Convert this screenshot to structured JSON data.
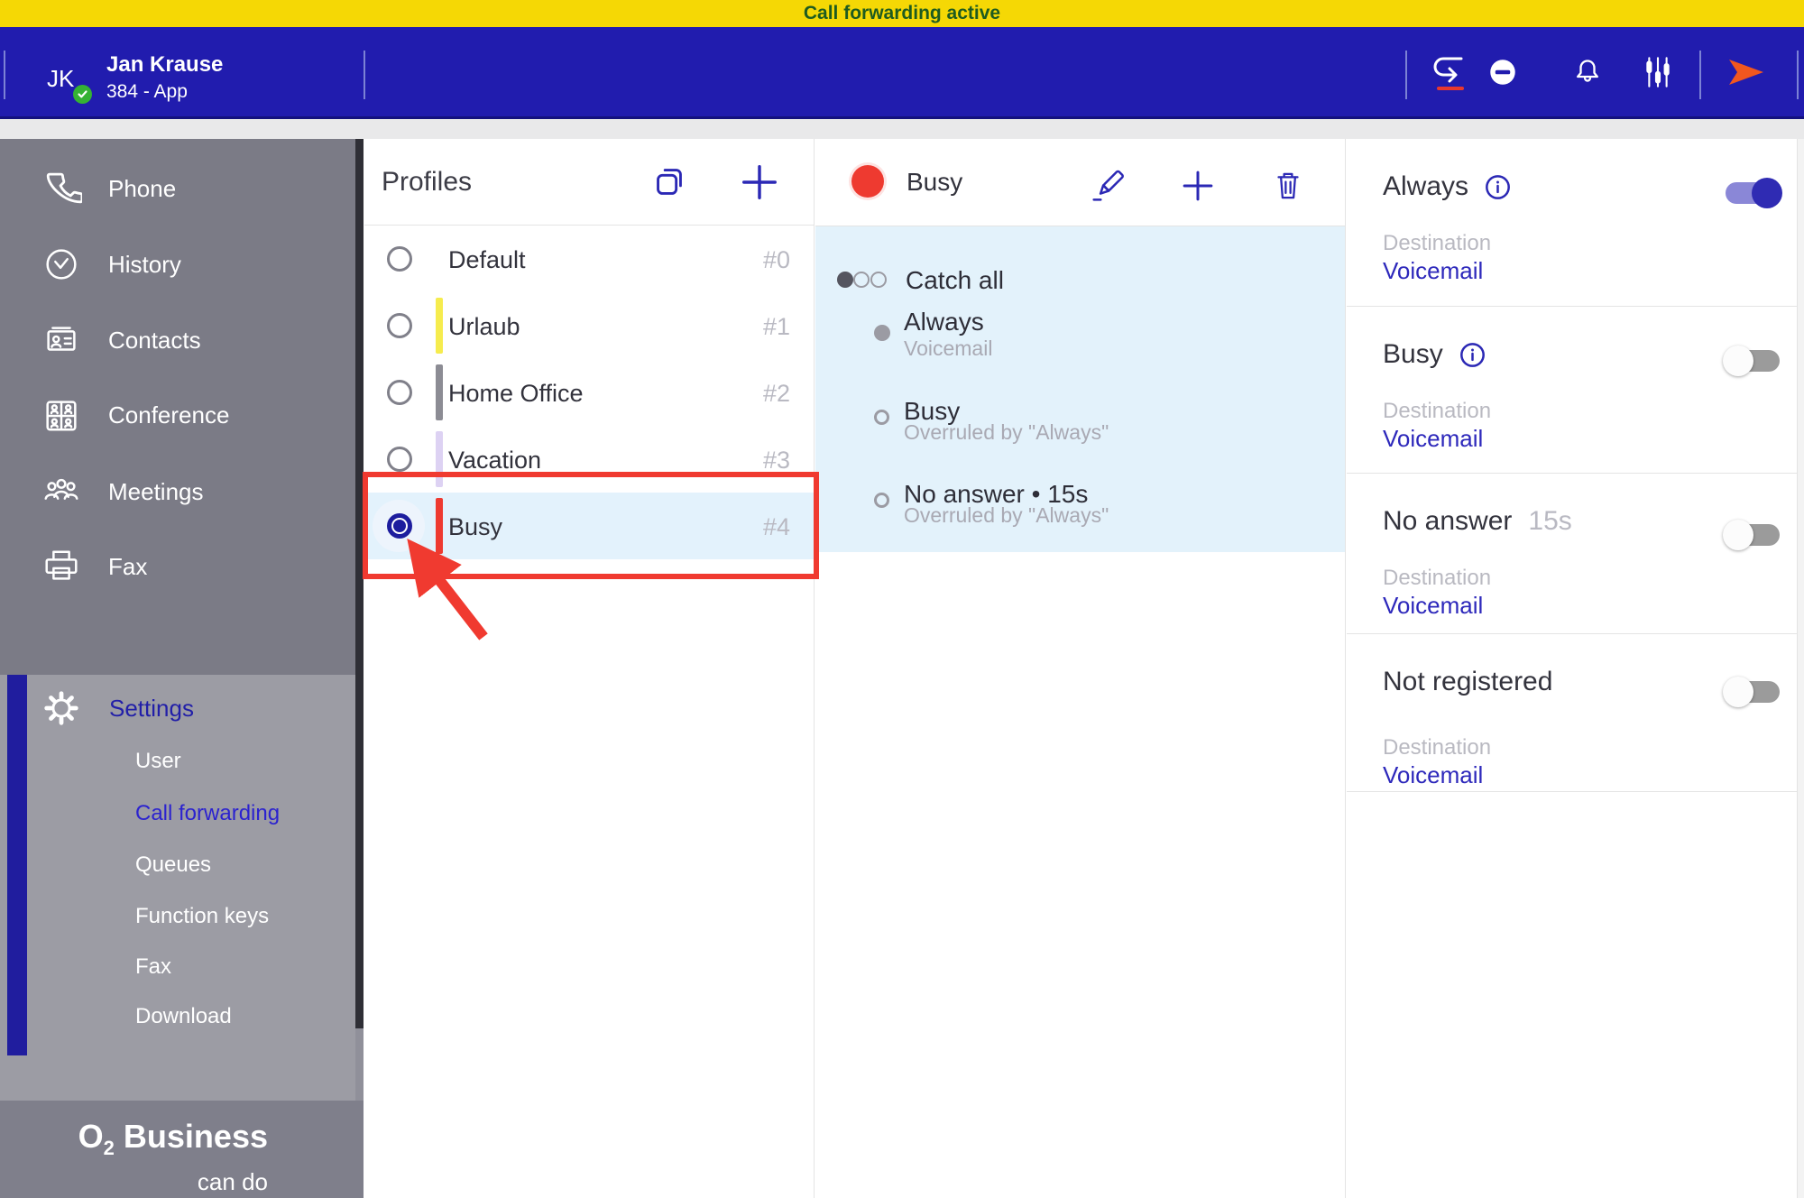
{
  "colors": {
    "banner_bg": "#f5d805",
    "banner_text": "#1e5b20",
    "header_bg": "#211cae",
    "accent_indigo": "#2b28b5",
    "sidebar_bg": "#7b7b86",
    "sidebar_active_bg": "#9c9ca4",
    "selection_blue": "#e3f2fb",
    "alert_red": "#ee3a30",
    "annotation_red": "#f03a30",
    "toggle_on_knob": "#2f2bb3",
    "toggle_on_track": "#8a87d7",
    "toggle_off_knob": "#fcfcfc",
    "toggle_off_track": "#9b9b9b",
    "status_green": "#35b234"
  },
  "banner": {
    "text": "Call forwarding active"
  },
  "header": {
    "initials": "JK",
    "name": "Jan Krause",
    "line2": "384 - App",
    "icons": [
      "call-forwarding-icon",
      "do-not-disturb-icon",
      "notifications-icon",
      "audio-settings-icon",
      "send-icon"
    ]
  },
  "sidebar": {
    "items": [
      {
        "label": "Phone",
        "icon": "phone-icon"
      },
      {
        "label": "History",
        "icon": "history-icon"
      },
      {
        "label": "Contacts",
        "icon": "contacts-icon"
      },
      {
        "label": "Conference",
        "icon": "conference-icon"
      },
      {
        "label": "Meetings",
        "icon": "meetings-icon"
      },
      {
        "label": "Fax",
        "icon": "fax-icon"
      }
    ],
    "settings": {
      "label": "Settings",
      "icon": "gear-icon",
      "subitems": [
        {
          "label": "User",
          "active": false
        },
        {
          "label": "Call forwarding",
          "active": true
        },
        {
          "label": "Queues",
          "active": false
        },
        {
          "label": "Function keys",
          "active": false
        },
        {
          "label": "Fax",
          "active": false
        },
        {
          "label": "Download",
          "active": false
        }
      ]
    },
    "logo": {
      "prefix": "O",
      "sub": "2",
      "rest": "Business",
      "tagline": "can do"
    }
  },
  "profiles": {
    "title": "Profiles",
    "actions": [
      "copy-profile-icon",
      "add-profile-icon"
    ],
    "rows": [
      {
        "name": "Default",
        "tag": "#0",
        "color": "",
        "selected": false
      },
      {
        "name": "Urlaub",
        "tag": "#1",
        "color": "#f6ec4e",
        "selected": false
      },
      {
        "name": "Home Office",
        "tag": "#2",
        "color": "#8c8c94",
        "selected": false
      },
      {
        "name": "Vacation",
        "tag": "#3",
        "color": "#ddd2f3",
        "selected": false
      },
      {
        "name": "Busy",
        "tag": "#4",
        "color": "#ee3a30",
        "selected": true
      }
    ]
  },
  "detail": {
    "title": "Busy",
    "color": "#ee3a30",
    "actions": [
      "edit-profile-icon",
      "add-rule-icon",
      "delete-profile-icon"
    ],
    "entries": [
      {
        "title": "Catch all",
        "subtitle": ""
      },
      {
        "title": "Always",
        "subtitle": "Voicemail"
      },
      {
        "title": "Busy",
        "subtitle": "Overruled by \"Always\""
      },
      {
        "title": "No answer • 15s",
        "subtitle": "Overruled by \"Always\""
      }
    ]
  },
  "rules": {
    "sections": [
      {
        "title": "Always",
        "suffix": "",
        "has_info": true,
        "enabled": true,
        "destination_label": "Destination",
        "destination": "Voicemail"
      },
      {
        "title": "Busy",
        "suffix": "",
        "has_info": true,
        "enabled": false,
        "destination_label": "Destination",
        "destination": "Voicemail"
      },
      {
        "title": "No answer",
        "suffix": "15s",
        "has_info": false,
        "enabled": false,
        "destination_label": "Destination",
        "destination": "Voicemail"
      },
      {
        "title": "Not registered",
        "suffix": "",
        "has_info": false,
        "enabled": false,
        "destination_label": "Destination",
        "destination": "Voicemail"
      }
    ]
  },
  "annotation": {
    "shape": "rectangle-and-arrow",
    "color": "#f03a30",
    "points_at": "Busy profile radio button"
  }
}
